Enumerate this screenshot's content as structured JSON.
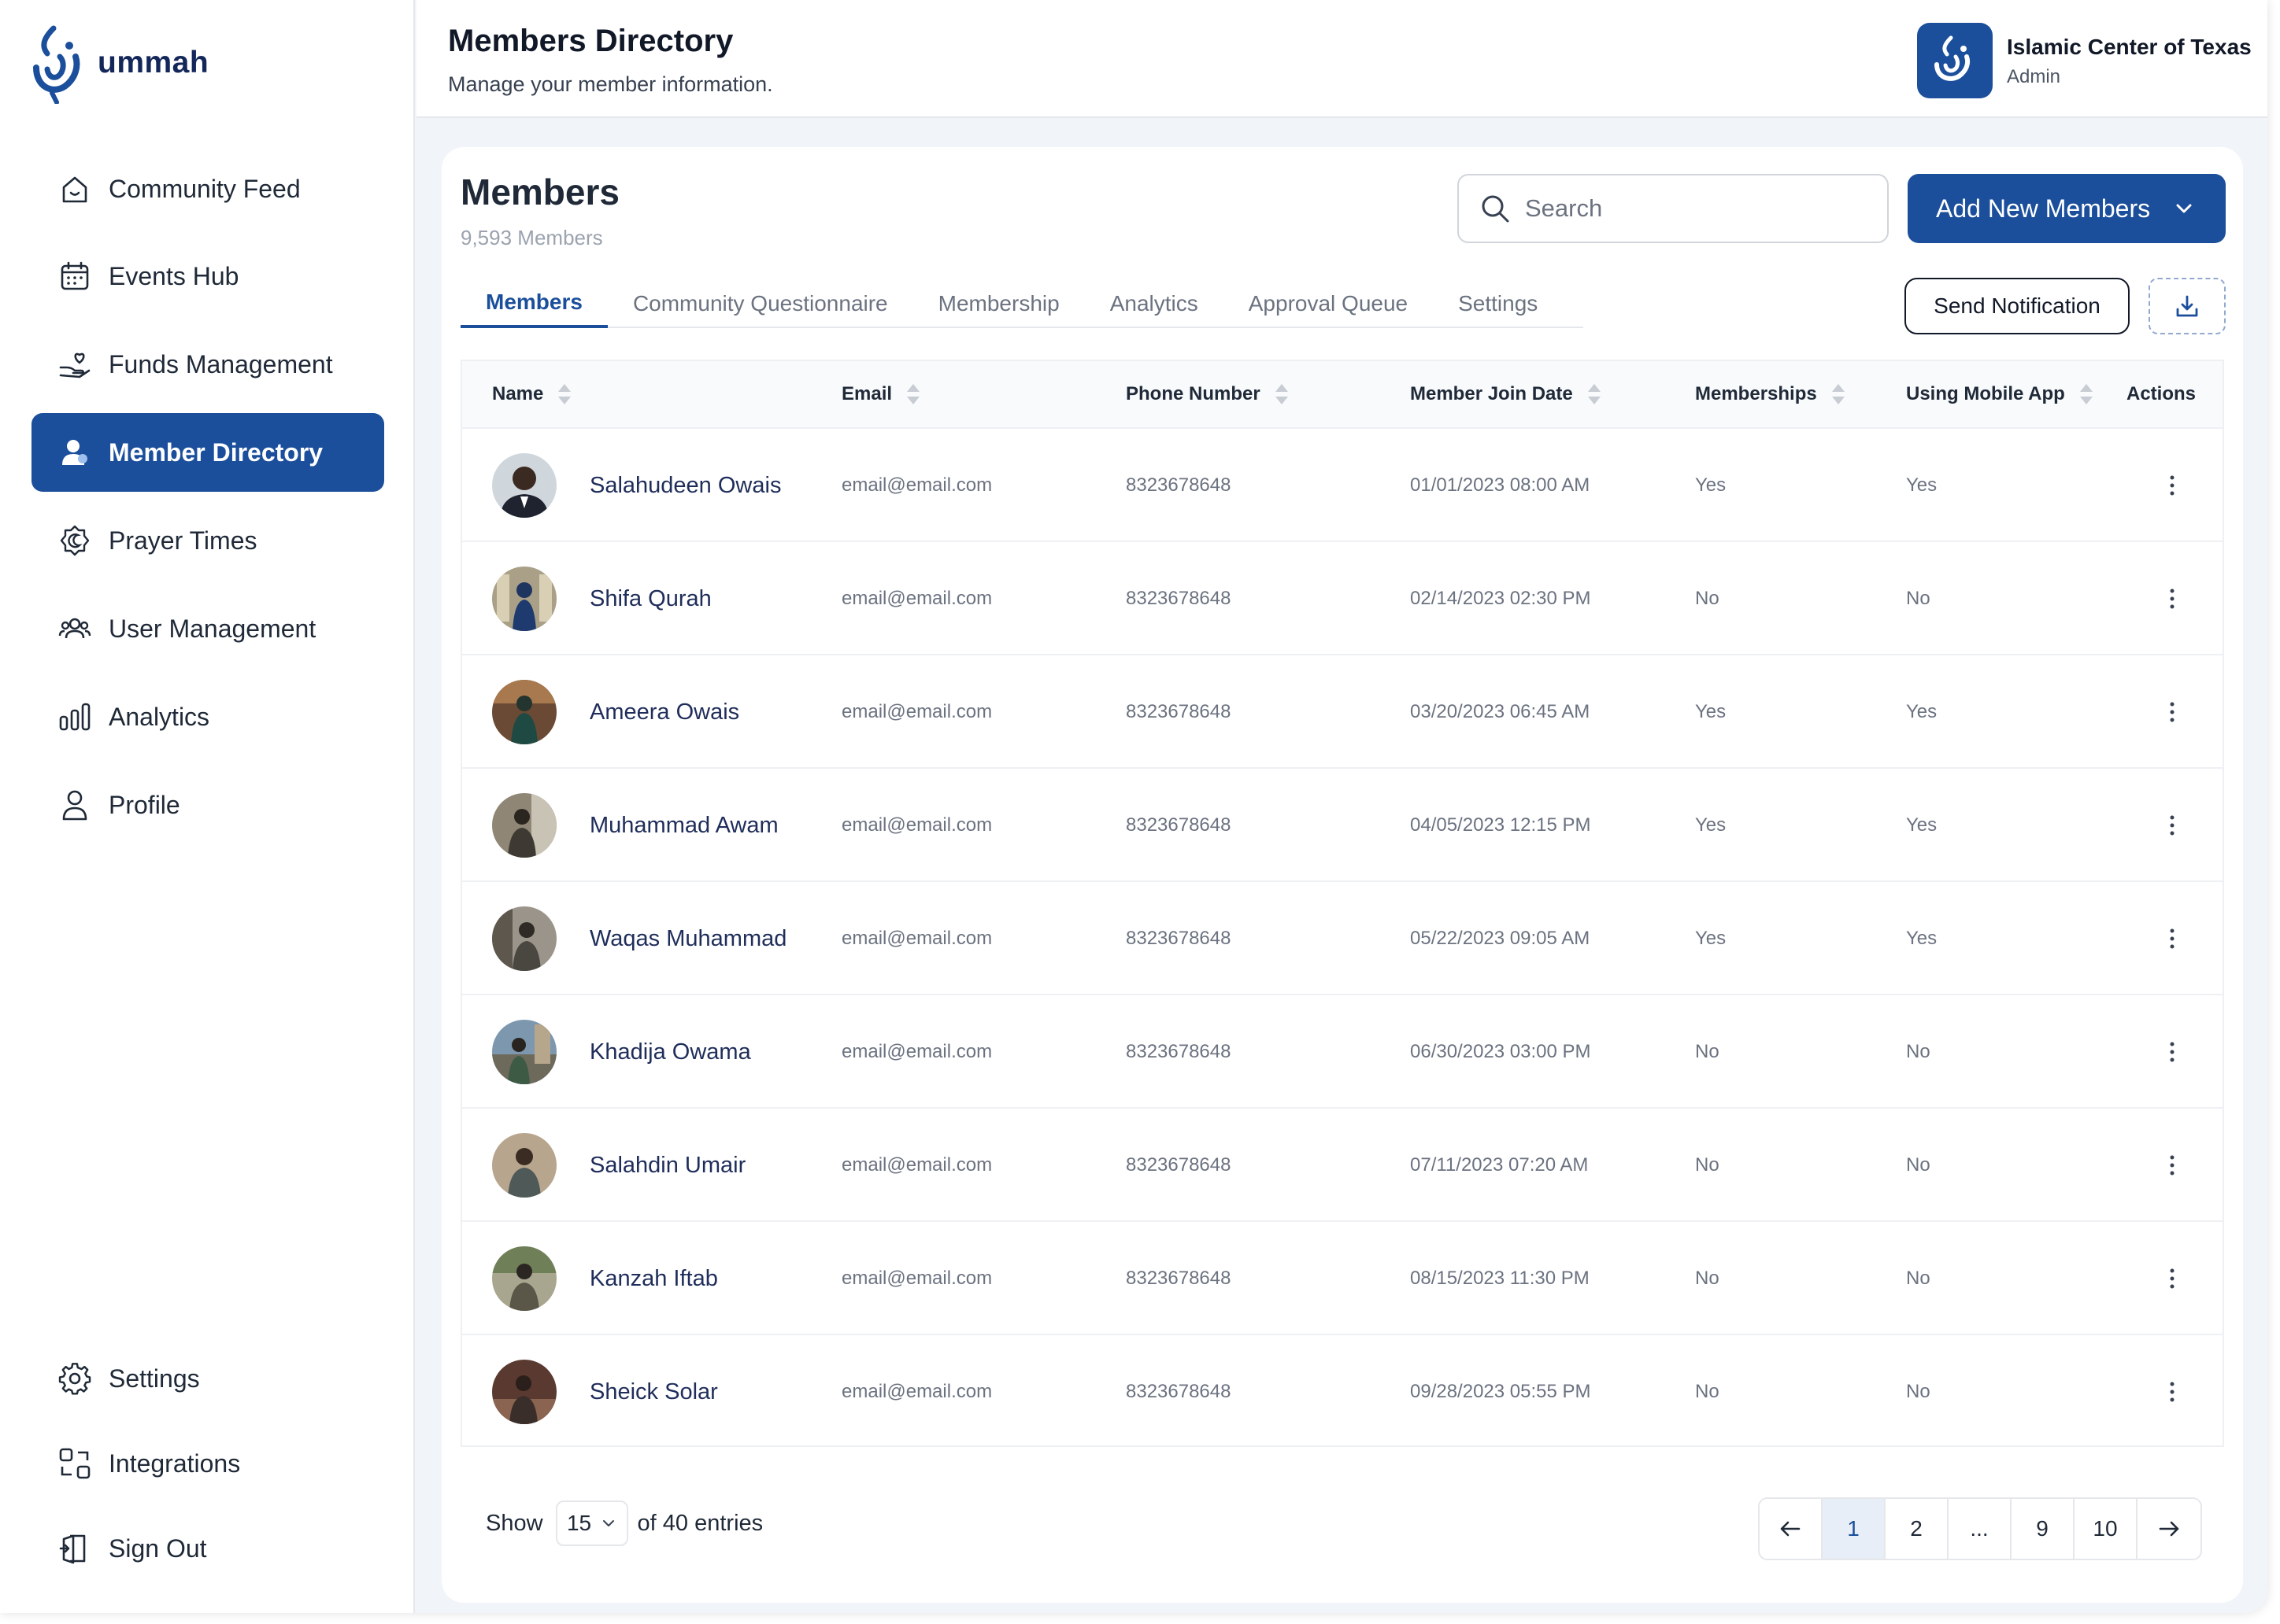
{
  "brand": {
    "name": "ummah"
  },
  "sidebar": {
    "items": [
      {
        "label": "Community Feed",
        "icon": "home-icon",
        "active": false
      },
      {
        "label": "Events Hub",
        "icon": "calendar-icon",
        "active": false
      },
      {
        "label": "Funds Management",
        "icon": "hand-heart-icon",
        "active": false
      },
      {
        "label": "Member Directory",
        "icon": "user-icon",
        "active": true
      },
      {
        "label": "Prayer Times",
        "icon": "moon-badge-icon",
        "active": false
      },
      {
        "label": "User Management",
        "icon": "users-icon",
        "active": false
      },
      {
        "label": "Analytics",
        "icon": "bar-chart-icon",
        "active": false
      },
      {
        "label": "Profile",
        "icon": "person-icon",
        "active": false
      }
    ],
    "bottom_items": [
      {
        "label": "Settings",
        "icon": "gear-icon"
      },
      {
        "label": "Integrations",
        "icon": "integrations-icon"
      },
      {
        "label": "Sign Out",
        "icon": "sign-out-icon"
      }
    ]
  },
  "header": {
    "title": "Members Directory",
    "subtitle": "Manage your member information.",
    "org_name": "Islamic Center of Texas",
    "org_role": "Admin"
  },
  "card": {
    "title": "Members",
    "count": "9,593 Members",
    "search_placeholder": "Search",
    "add_button": "Add New Members",
    "notify_button": "Send Notification",
    "tabs": [
      "Members",
      "Community Questionnaire",
      "Membership",
      "Analytics",
      "Approval Queue",
      "Settings"
    ],
    "active_tab": "Members"
  },
  "table": {
    "columns": [
      "Name",
      "Email",
      "Phone Number",
      "Member Join Date",
      "Memberships",
      "Using Mobile App",
      "Actions"
    ],
    "rows": [
      {
        "name": "Salahudeen Owais",
        "email": "email@email.com",
        "phone": "8323678648",
        "joined": "01/01/2023 08:00 AM",
        "memberships": "Yes",
        "mobile": "Yes"
      },
      {
        "name": "Shifa Qurah",
        "email": "email@email.com",
        "phone": "8323678648",
        "joined": "02/14/2023 02:30 PM",
        "memberships": "No",
        "mobile": "No"
      },
      {
        "name": "Ameera Owais",
        "email": "email@email.com",
        "phone": "8323678648",
        "joined": "03/20/2023 06:45 AM",
        "memberships": "Yes",
        "mobile": "Yes"
      },
      {
        "name": "Muhammad Awam",
        "email": "email@email.com",
        "phone": "8323678648",
        "joined": "04/05/2023 12:15 PM",
        "memberships": "Yes",
        "mobile": "Yes"
      },
      {
        "name": "Waqas Muhammad",
        "email": "email@email.com",
        "phone": "8323678648",
        "joined": "05/22/2023 09:05 AM",
        "memberships": "Yes",
        "mobile": "Yes"
      },
      {
        "name": "Khadija Owama",
        "email": "email@email.com",
        "phone": "8323678648",
        "joined": "06/30/2023 03:00 PM",
        "memberships": "No",
        "mobile": "No"
      },
      {
        "name": "Salahdin Umair",
        "email": "email@email.com",
        "phone": "8323678648",
        "joined": "07/11/2023 07:20 AM",
        "memberships": "No",
        "mobile": "No"
      },
      {
        "name": "Kanzah Iftab",
        "email": "email@email.com",
        "phone": "8323678648",
        "joined": "08/15/2023 11:30 PM",
        "memberships": "No",
        "mobile": "No"
      },
      {
        "name": "Sheick Solar",
        "email": "email@email.com",
        "phone": "8323678648",
        "joined": "09/28/2023 05:55 PM",
        "memberships": "No",
        "mobile": "No"
      }
    ]
  },
  "footer": {
    "show_label": "Show",
    "page_size": "15",
    "entries_label": "of 40 entries",
    "pages": [
      "1",
      "2",
      "...",
      "9",
      "10"
    ],
    "current_page": "1"
  },
  "colors": {
    "primary": "#1b4f9c",
    "background": "#f1f4f8",
    "name_text": "#1f2d5a"
  }
}
